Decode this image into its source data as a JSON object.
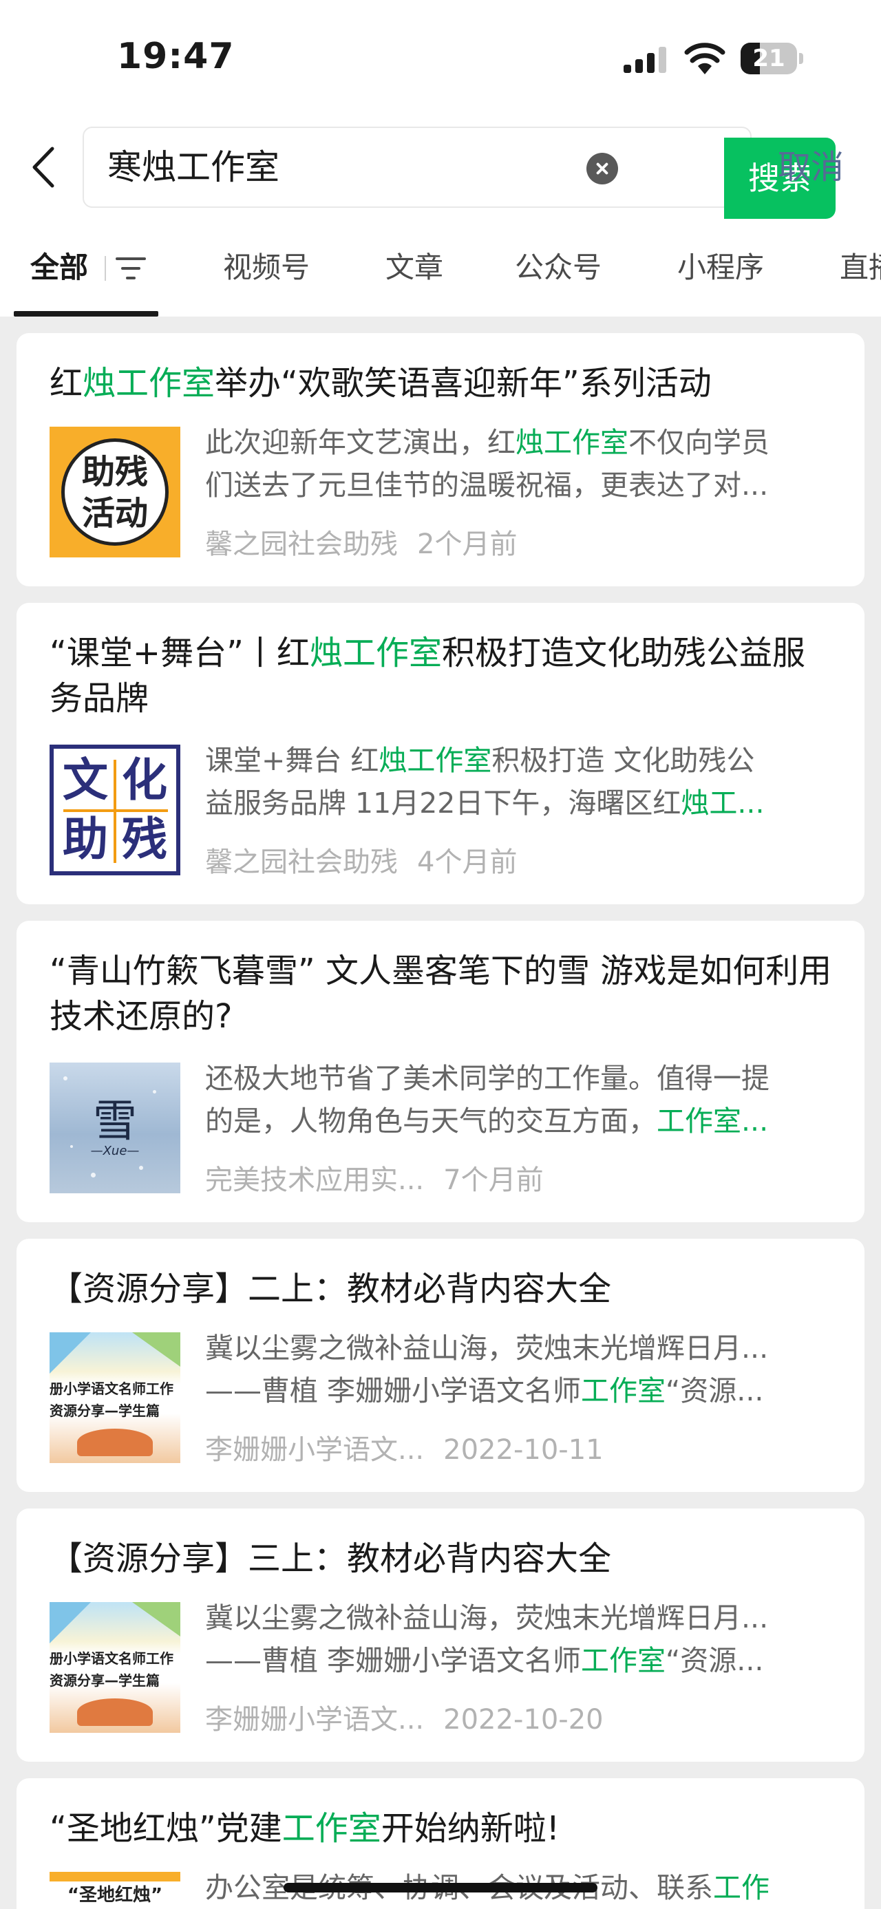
{
  "status_bar": {
    "time": "19:47",
    "battery": "21"
  },
  "search": {
    "query": "寒烛工作室",
    "button": "搜索",
    "cancel": "取消"
  },
  "tabs": [
    "全部",
    "视频号",
    "文章",
    "公众号",
    "小程序",
    "直播"
  ],
  "results": [
    {
      "title": [
        [
          "红",
          0
        ],
        [
          "烛工作室",
          1
        ],
        [
          "举办“欢歌笑语喜迎新年”系列活动",
          0
        ]
      ],
      "thumb_text": [
        "助残",
        "活动"
      ],
      "snippet": [
        [
          [
            "此次迎新年文艺演出，红",
            0
          ],
          [
            "烛工作室",
            1
          ],
          [
            "不仅向学员",
            0
          ]
        ],
        [
          [
            "们送去了元旦佳节的温暖祝福，更表达了对...",
            0
          ]
        ]
      ],
      "source": "馨之园社会助残",
      "time": "2个月前"
    },
    {
      "title": [
        [
          "“课堂+舞台”丨红",
          0
        ],
        [
          "烛工作室",
          1
        ],
        [
          "积极打造文化助残公益服务品牌",
          0
        ]
      ],
      "thumb_text": [
        "文",
        "化",
        "助",
        "残"
      ],
      "snippet": [
        [
          [
            "课堂+舞台 红",
            0
          ],
          [
            "烛工作室",
            1
          ],
          [
            "积极打造 文化助残公",
            0
          ]
        ],
        [
          [
            "益服务品牌 11月22日下午，海曙区红",
            0
          ],
          [
            "烛工...",
            1
          ]
        ]
      ],
      "source": "馨之园社会助残",
      "time": "4个月前"
    },
    {
      "title": [
        [
          "“青山竹簌飞暮雪” 文人墨客笔下的雪 游戏是如何利用技术还原的?",
          0
        ]
      ],
      "thumb_text": [
        "雪",
        "—Xue—"
      ],
      "snippet": [
        [
          [
            "还极大地节省了美术同学的工作量。值得一提",
            0
          ]
        ],
        [
          [
            "的是，人物角色与天气的交互方面，",
            0
          ],
          [
            "工作室...",
            1
          ]
        ]
      ],
      "source": "完美技术应用实...",
      "time": "7个月前"
    },
    {
      "title": [
        [
          "【资源分享】二上：教材必背内容大全",
          0
        ]
      ],
      "thumb_text": [
        "册小学语文名师工作",
        "资源分享—学生篇"
      ],
      "snippet": [
        [
          [
            "冀以尘雾之微补益山海，荧烛末光增辉日月...",
            0
          ]
        ],
        [
          [
            "——曹植 李姗姗小学语文名师",
            0
          ],
          [
            "工作室",
            1
          ],
          [
            "“资源...",
            0
          ]
        ]
      ],
      "source": "李姗姗小学语文...",
      "time": "2022-10-11"
    },
    {
      "title": [
        [
          "【资源分享】三上：教材必背内容大全",
          0
        ]
      ],
      "thumb_text": [
        "册小学语文名师工作",
        "资源分享—学生篇"
      ],
      "snippet": [
        [
          [
            "冀以尘雾之微补益山海，荧烛末光增辉日月...",
            0
          ]
        ],
        [
          [
            "——曹植 李姗姗小学语文名师",
            0
          ],
          [
            "工作室",
            1
          ],
          [
            "“资源...",
            0
          ]
        ]
      ],
      "source": "李姗姗小学语文...",
      "time": "2022-10-20"
    },
    {
      "title": [
        [
          "“圣地红烛”党建",
          0
        ],
        [
          "工作室",
          1
        ],
        [
          "开始纳新啦!",
          0
        ]
      ],
      "thumb_text": [
        "“圣地红烛”"
      ],
      "snippet": [
        [
          [
            "办公室是统筹、协调、会议及活动、联系",
            0
          ],
          [
            "工作",
            1
          ]
        ]
      ],
      "source": "",
      "time": ""
    }
  ],
  "colors": {
    "accent": "#07c160",
    "highlight": "#06ad56",
    "link": "#576b95"
  }
}
